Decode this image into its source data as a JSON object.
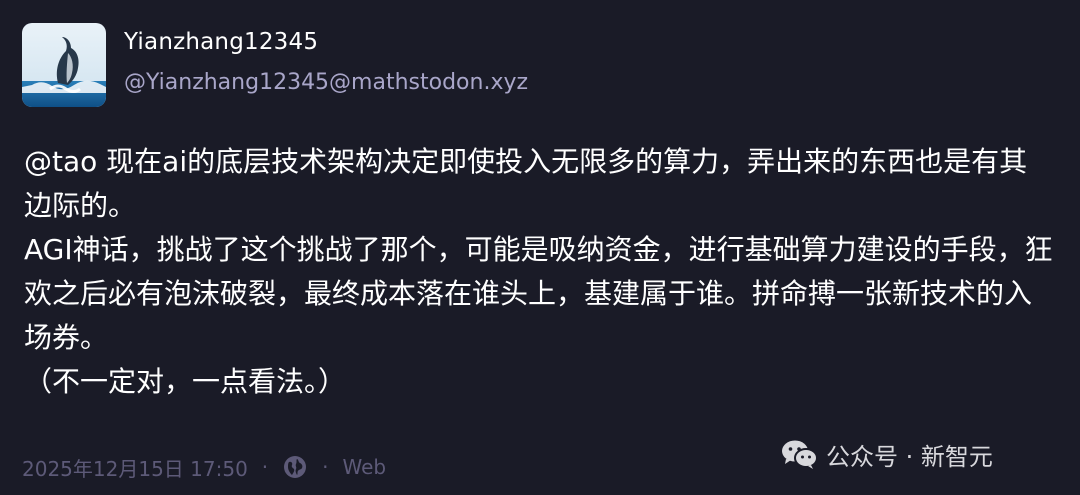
{
  "post": {
    "display_name": "Yianzhang12345",
    "handle": "@Yianzhang12345@mathstodon.xyz",
    "paragraphs": [
      {
        "mention": "@tao",
        "text": " 现在ai的底层技术架构决定即使投入无限多的算力，弄出来的东西也是有其边际的。"
      },
      {
        "mention": "",
        "text": "AGI神话，挑战了这个挑战了那个，可能是吸纳资金，进行基础算力建设的手段，狂欢之后必有泡沫破裂，最终成本落在谁头上，基建属于谁。拼命搏一张新技术的入场券。"
      },
      {
        "mention": "",
        "text": "（不一定对，一点看法。）"
      }
    ],
    "timestamp": "2025年12月15日 17:50",
    "separator": "·",
    "visibility_icon": "globe-icon",
    "client": "Web"
  },
  "watermark": {
    "icon": "wechat-icon",
    "text": "公众号 · 新智元"
  },
  "colors": {
    "background": "#1a1b27",
    "handle": "#a9a6c9",
    "footer": "#5d5a78"
  }
}
